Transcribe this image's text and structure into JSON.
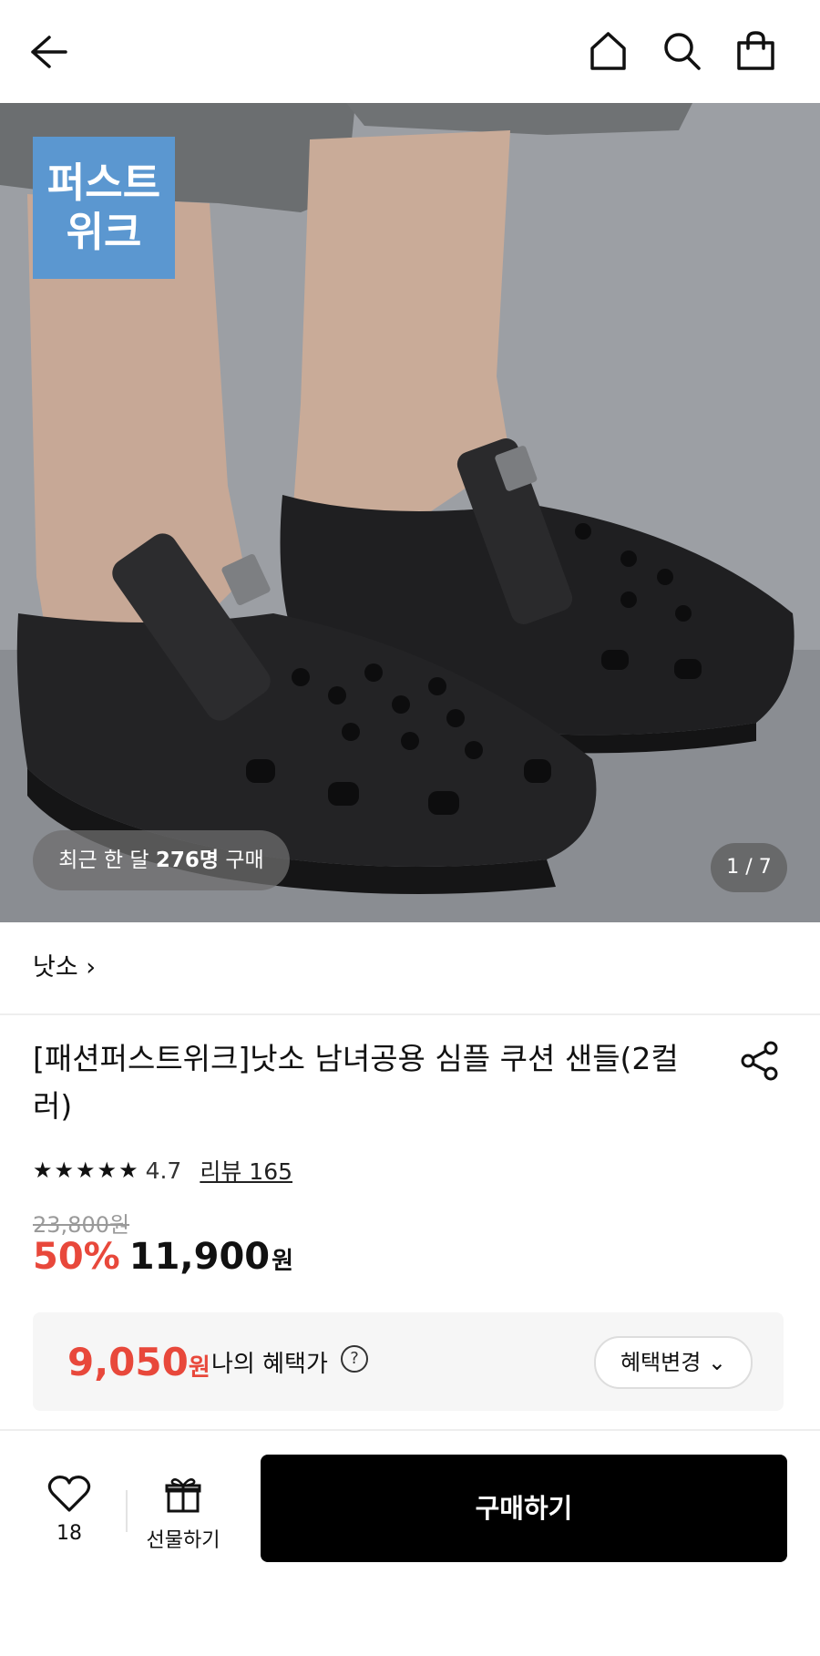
{
  "header": {
    "back_icon": "arrow-left-icon",
    "home_icon": "home-icon",
    "search_icon": "search-icon",
    "cart_icon": "shopping-bag-icon"
  },
  "hero": {
    "badge_line1": "퍼스트",
    "badge_line2": "위크",
    "recent_prefix": "최근 한 달 ",
    "recent_count": "276명",
    "recent_suffix": " 구매",
    "image_counter": "1 / 7"
  },
  "product": {
    "brand": "낫소 ›",
    "title": "[패션퍼스트위크]낫소 남녀공용 심플 쿠션 샌들(2컬러)",
    "rating": "4.7",
    "review_link": "리뷰 165",
    "original_price": "23,800원",
    "discount": "50%",
    "sale_price": "11,900",
    "currency": "원"
  },
  "benefit": {
    "price": "9,050",
    "currency": "원",
    "label": "나의 혜택가",
    "help": "?",
    "change_button": "혜택변경 ⌄"
  },
  "bottom_bar": {
    "like_count": "18",
    "gift_label": "선물하기",
    "buy_label": "구매하기"
  },
  "colors": {
    "accent_red": "#e8483b",
    "badge_blue": "#5b97d0",
    "buy_black": "#000000"
  }
}
